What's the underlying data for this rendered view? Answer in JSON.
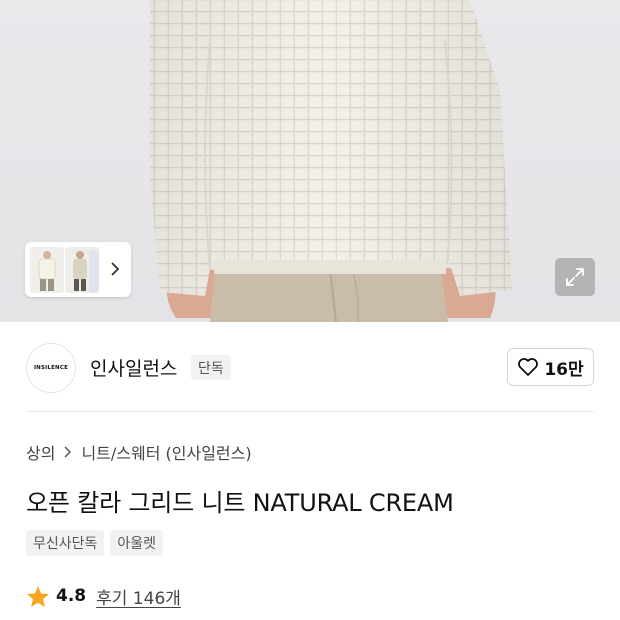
{
  "hero": {
    "icons": {
      "thumbnail_next": "chevron-right-icon",
      "expand": "expand-icon"
    }
  },
  "brand": {
    "logo_text": "INSILENCE",
    "name": "인사일런스",
    "badge": "단독",
    "like_icon": "heart-outline-icon",
    "like_count": "16만"
  },
  "breadcrumb": {
    "items": [
      "상의",
      "니트/스웨터 (인사일런스)"
    ],
    "separator_icon": "chevron-right-icon"
  },
  "product": {
    "title": "오픈 칼라 그리드 니트 NATURAL CREAM",
    "tags": [
      "무신사단독",
      "아울렛"
    ]
  },
  "rating": {
    "star_icon": "star-icon",
    "star_color": "#f5a623",
    "score": "4.8",
    "reviews_label": "후기 146개"
  }
}
